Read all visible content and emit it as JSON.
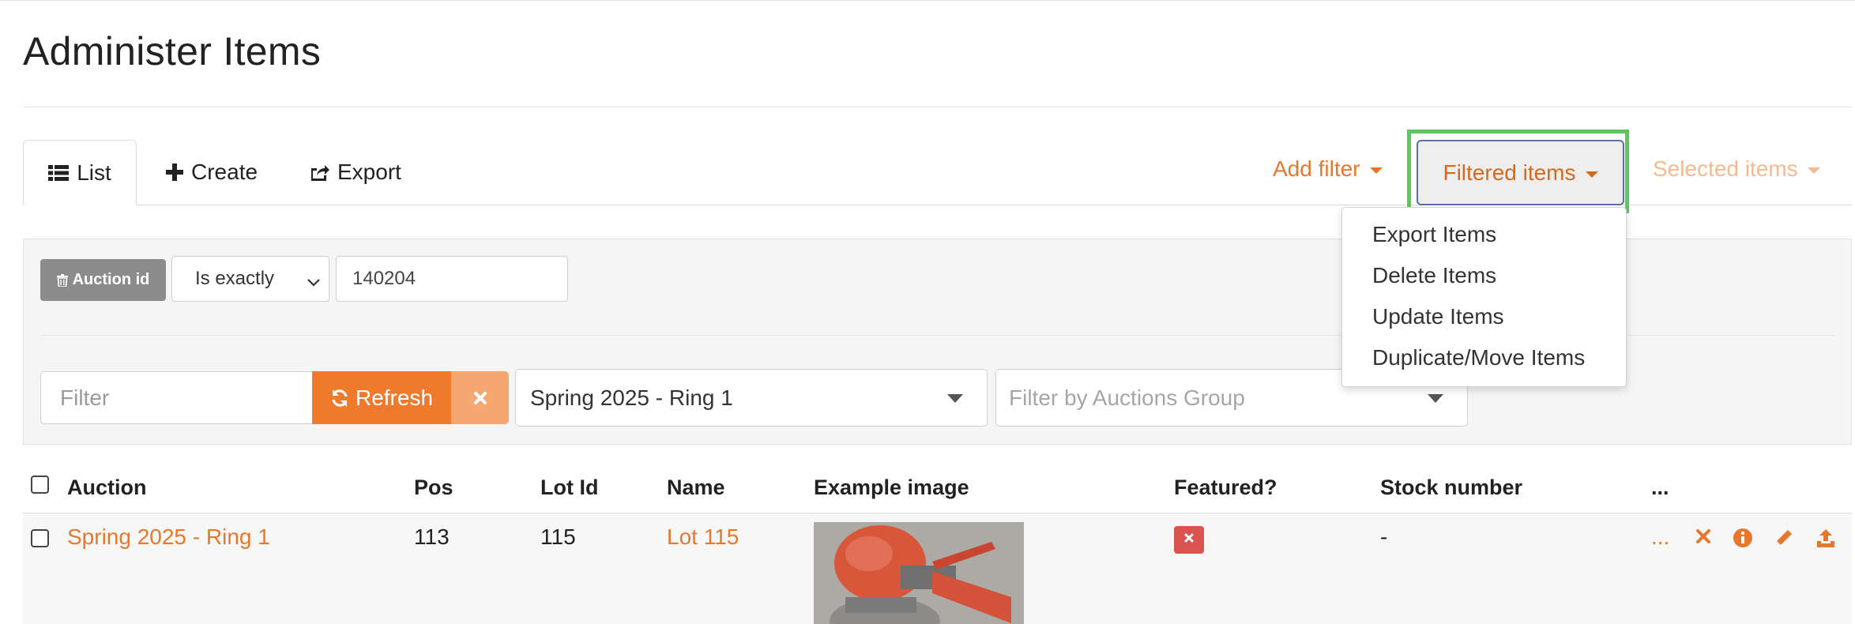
{
  "page": {
    "title": "Administer Items"
  },
  "tabs": [
    {
      "label": "List",
      "icon": "list-icon",
      "active": true
    },
    {
      "label": "Create",
      "icon": "plus-icon"
    },
    {
      "label": "Export",
      "icon": "share-icon"
    }
  ],
  "actions": {
    "add_filter": "Add filter",
    "filtered_items": "Filtered items",
    "selected_items": "Selected items"
  },
  "dropdown": {
    "items": [
      "Export Items",
      "Delete Items",
      "Update Items",
      "Duplicate/Move Items"
    ]
  },
  "filter": {
    "chip_label": "Auction id",
    "chip_icon": "trash-icon",
    "operator": "Is exactly",
    "value": "140204"
  },
  "search": {
    "placeholder": "Filter",
    "refresh_label": "Refresh",
    "clear_icon": "close-icon",
    "auction_select": "Spring 2025 - Ring 1",
    "group_placeholder": "Filter by Auctions Group"
  },
  "table": {
    "headers": [
      "Auction",
      "Pos",
      "Lot Id",
      "Name",
      "Example image",
      "Featured?",
      "Stock number",
      "..."
    ],
    "rows": [
      {
        "auction": "Spring 2025 - Ring 1",
        "pos": "113",
        "lot_id": "115",
        "name": "Lot 115",
        "featured": false,
        "stock_number": "-",
        "more": "..."
      }
    ]
  },
  "colors": {
    "accent": "#e8772e",
    "refresh": "#ef7a2c",
    "highlight": "#5cc85c",
    "danger": "#d9534f"
  }
}
